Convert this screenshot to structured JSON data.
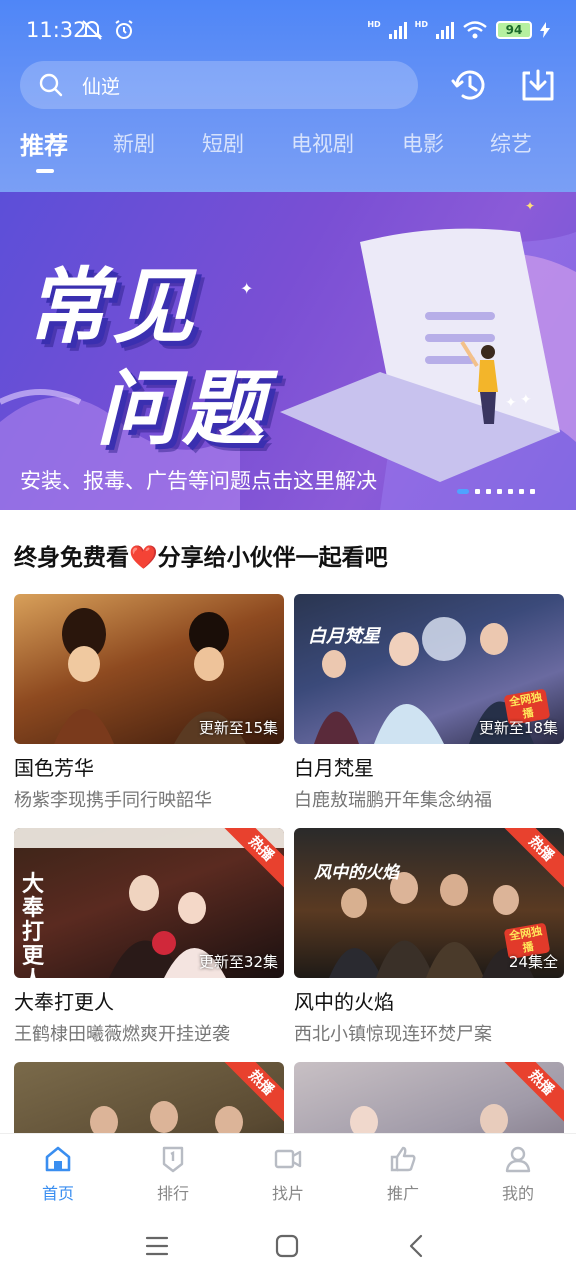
{
  "status_bar": {
    "time": "11:32",
    "battery": "94",
    "net_label_1": "HD",
    "net_label_2": "HD"
  },
  "search": {
    "query": "仙逆"
  },
  "tabs": [
    {
      "label": "推荐",
      "active": true
    },
    {
      "label": "新剧",
      "active": false
    },
    {
      "label": "短剧",
      "active": false
    },
    {
      "label": "电视剧",
      "active": false
    },
    {
      "label": "电影",
      "active": false
    },
    {
      "label": "综艺",
      "active": false
    }
  ],
  "banner": {
    "title_line1": "常见",
    "title_line2": "问题",
    "caption": "安装、报毒、广告等问题点击这里解决",
    "slide_count": 7,
    "active_slide": 1
  },
  "share": {
    "text_before": "终身免费看",
    "heart": "❤️",
    "text_after": "分享给小伙伴一起看吧"
  },
  "cards": [
    {
      "title": "国色芳华",
      "desc": "杨紫李现携手同行映韶华",
      "episode_badge": "更新至15集",
      "hot": "",
      "stamp": ""
    },
    {
      "title": "白月梵星",
      "desc": "白鹿敖瑞鹏开年集念纳福",
      "episode_badge": "更新至18集",
      "hot": "",
      "stamp": "全网独播",
      "poster_text": "白月梵星"
    },
    {
      "title": "大奉打更人",
      "desc": "王鹤棣田曦薇燃爽开挂逆袭",
      "episode_badge": "更新至32集",
      "hot": "热播",
      "stamp": "",
      "poster_text": "大奉打更人"
    },
    {
      "title": "风中的火焰",
      "desc": "西北小镇惊现连环焚尸案",
      "episode_badge": "24集全",
      "hot": "热播",
      "stamp": "全网独播",
      "poster_text": "风中的火焰"
    },
    {
      "title": "",
      "desc": "",
      "episode_badge": "",
      "hot": "热播",
      "stamp": ""
    },
    {
      "title": "",
      "desc": "",
      "episode_badge": "",
      "hot": "热播",
      "stamp": ""
    }
  ],
  "bottom_nav": [
    {
      "label": "首页",
      "icon": "home-icon",
      "active": true
    },
    {
      "label": "排行",
      "icon": "ranking-icon",
      "active": false
    },
    {
      "label": "找片",
      "icon": "video-camera-icon",
      "active": false
    },
    {
      "label": "推广",
      "icon": "thumbs-up-icon",
      "active": false
    },
    {
      "label": "我的",
      "icon": "person-icon",
      "active": false
    }
  ],
  "colors": {
    "header_blue": "#5a8cf6",
    "accent_blue": "#3a8ef0",
    "banner_purple": "#6c4fd8",
    "hot_red": "#e8412e"
  }
}
